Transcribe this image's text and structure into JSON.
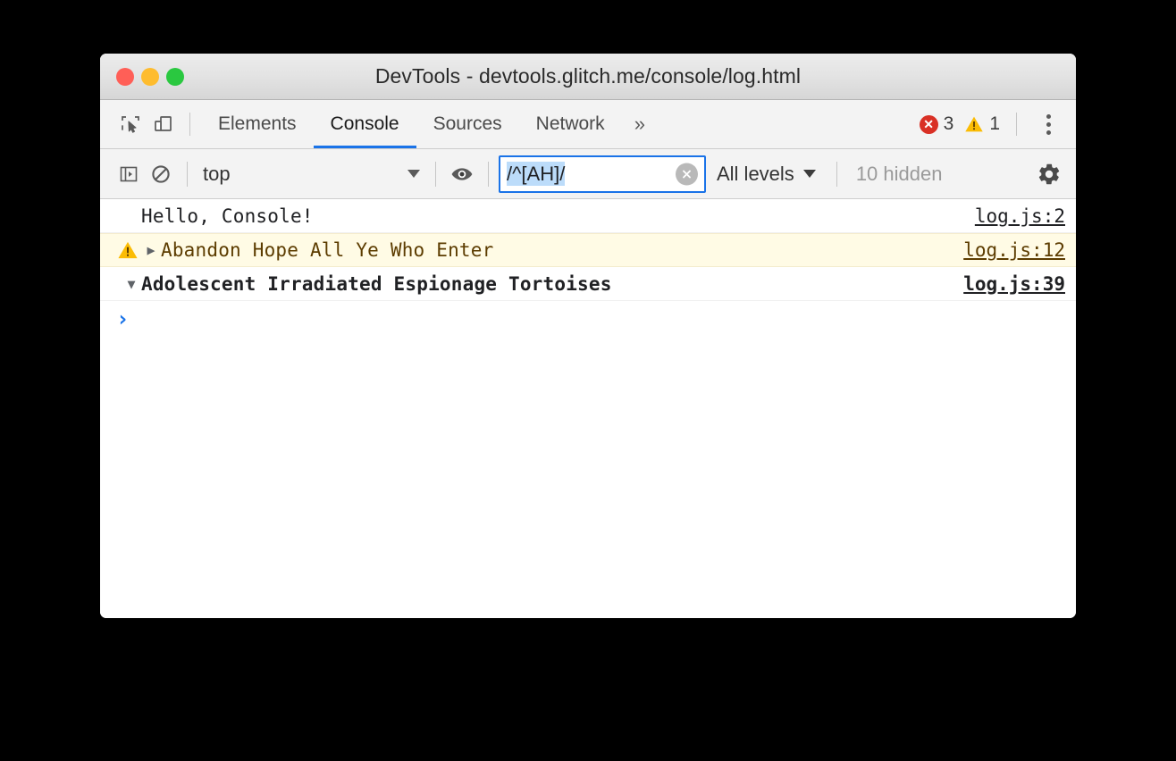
{
  "window": {
    "title": "DevTools - devtools.glitch.me/console/log.html",
    "traffic_lights": [
      {
        "name": "close",
        "color": "#ff5f57"
      },
      {
        "name": "minimize",
        "color": "#febc2e"
      },
      {
        "name": "zoom",
        "color": "#2ac840"
      }
    ]
  },
  "tabbar": {
    "inspect_icon": "inspect-element-icon",
    "device_icon": "device-toolbar-icon",
    "tabs": [
      {
        "label": "Elements",
        "active": false
      },
      {
        "label": "Console",
        "active": true
      },
      {
        "label": "Sources",
        "active": false
      },
      {
        "label": "Network",
        "active": false
      }
    ],
    "overflow_label": "»",
    "error_count": "3",
    "warning_count": "1",
    "error_glyph": "✕",
    "warning_glyph": "!",
    "menu_icon": "kebab-menu-icon"
  },
  "filterbar": {
    "sidebar_icon": "console-sidebar-toggle-icon",
    "clear_console_icon": "clear-console-icon",
    "context": {
      "value": "top",
      "options": [
        "top"
      ]
    },
    "live_expression_icon": "eye-icon",
    "filter": {
      "value": "/^[AH]/",
      "placeholder": "Filter",
      "selected": true,
      "selection_color": "#bcdcfa",
      "focus_border_color": "#1a73e8",
      "clear_glyph": "✕"
    },
    "levels": {
      "label": "All levels"
    },
    "hidden_label": "10 hidden",
    "settings_icon": "gear-icon"
  },
  "console": {
    "messages": [
      {
        "text": "Hello, Console!",
        "source": "log.js:2",
        "level": "log",
        "icon": null,
        "disclosure": null,
        "bold": false
      },
      {
        "text": "Abandon Hope All Ye Who Enter",
        "source": "log.js:12",
        "level": "warning",
        "icon": "warning-triangle-icon",
        "disclosure": "▶",
        "bold": false
      },
      {
        "text": "Adolescent Irradiated Espionage Tortoises",
        "source": "log.js:39",
        "level": "group",
        "icon": null,
        "disclosure": "▼",
        "bold": true
      }
    ],
    "prompt_glyph": "›"
  }
}
